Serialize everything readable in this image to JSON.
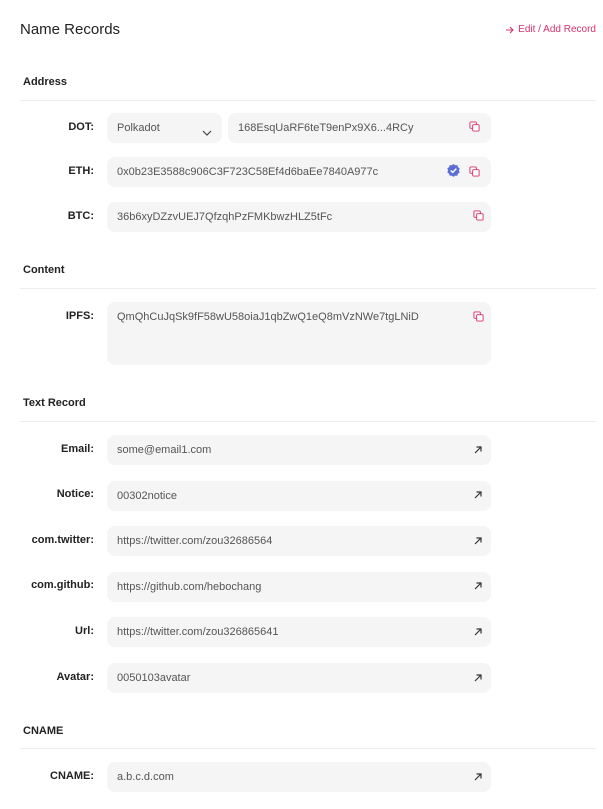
{
  "header": {
    "title": "Name Records",
    "edit_label": "Edit / Add Record"
  },
  "sections": {
    "address": "Address",
    "content": "Content",
    "text_record": "Text Record",
    "cname": "CNAME"
  },
  "address": {
    "dot": {
      "label": "DOT:",
      "network": "Polkadot",
      "value": "168EsqUaRF6teT9enPx9X6...4RCy"
    },
    "eth": {
      "label": "ETH:",
      "value": "0x0b23E3588c906C3F723C58Ef4d6baEe7840A977c",
      "verified": true
    },
    "btc": {
      "label": "BTC:",
      "value": "36b6xyDZzvUEJ7QfzqhPzFMKbwzHLZ5tFc"
    }
  },
  "content": {
    "ipfs": {
      "label": "IPFS:",
      "value": "QmQhCuJqSk9fF58wU58oiaJ1qbZwQ1eQ8mVzNWe7tgLNiD"
    }
  },
  "text_record": {
    "email": {
      "label": "Email:",
      "value": "some@email1.com"
    },
    "notice": {
      "label": "Notice:",
      "value": "00302notice"
    },
    "twitter": {
      "label": "com.twitter:",
      "value": "https://twitter.com/zou32686564"
    },
    "github": {
      "label": "com.github:",
      "value": "https://github.com/hebochang"
    },
    "url": {
      "label": "Url:",
      "value": "https://twitter.com/zou326865641"
    },
    "avatar": {
      "label": "Avatar:",
      "value": "0050103avatar"
    }
  },
  "cname": {
    "cname": {
      "label": "CNAME:",
      "value": "a.b.c.d.com"
    }
  },
  "colors": {
    "accent": "#d6336c",
    "verified": "#5b6fd6",
    "field_bg": "#f5f5f5"
  },
  "icons": {
    "copy": "copy-icon",
    "open": "arrow-up-right-icon",
    "verified": "verified-badge-icon",
    "chevron": "chevron-down-icon"
  }
}
